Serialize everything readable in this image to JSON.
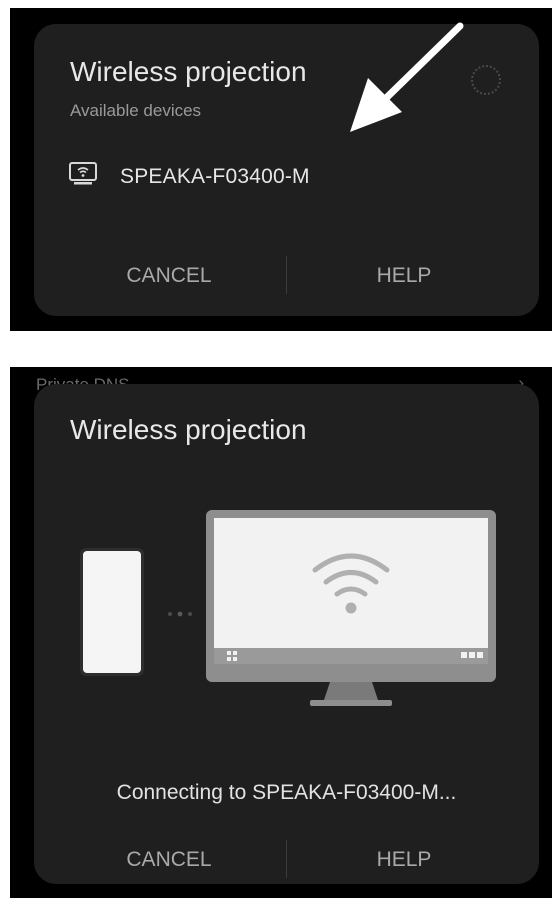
{
  "picker": {
    "title": "Wireless projection",
    "subtitle": "Available devices",
    "device": {
      "icon": "screen-mirroring-icon",
      "name": "SPEAKA-F03400-M"
    },
    "cancel_label": "CANCEL",
    "help_label": "HELP"
  },
  "connecting": {
    "background_peek": "Private DNS",
    "title": "Wireless projection",
    "status_text": "Connecting to SPEAKA-F03400-M...",
    "cancel_label": "CANCEL",
    "help_label": "HELP"
  },
  "colors": {
    "dialog_bg": "#1f1f1f",
    "frame_bg": "#000000",
    "text_primary": "#e8e8e8",
    "text_secondary": "#9a9a9a",
    "monitor_screen": "#f2f2f2"
  }
}
